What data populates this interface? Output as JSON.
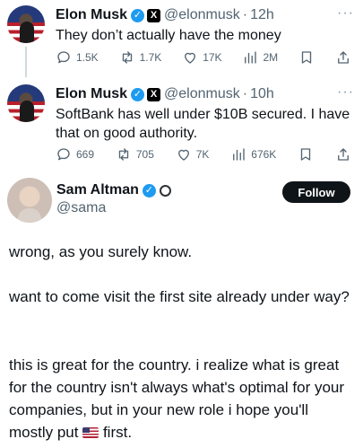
{
  "tweets": [
    {
      "author_name": "Elon Musk",
      "author_handle": "@elonmusk",
      "time": "12h",
      "text": "They don’t actually have the money",
      "stats": {
        "replies": "1.5K",
        "reposts": "1.7K",
        "likes": "17K",
        "views": "2M"
      }
    },
    {
      "author_name": "Elon Musk",
      "author_handle": "@elonmusk",
      "time": "10h",
      "text": "SoftBank has well under $10B secured. I have that on good authority.",
      "stats": {
        "replies": "669",
        "reposts": "705",
        "likes": "7K",
        "views": "676K"
      }
    }
  ],
  "main_post": {
    "author_name": "Sam Altman",
    "author_handle": "@sama",
    "follow_label": "Follow",
    "paragraphs": [
      "wrong, as you surely know.",
      "want to come visit the first site already under way?",
      "this is great for the country. i realize what is great for the country isn't always what's optimal for your companies, but in your new role i hope you'll mostly put",
      "first."
    ]
  },
  "icons": [
    "reply-icon",
    "repost-icon",
    "like-icon",
    "views-icon",
    "bookmark-icon",
    "share-icon",
    "more-icon",
    "verified-icon",
    "x-affiliate-icon",
    "openai-affiliate-icon",
    "us-flag-emoji"
  ],
  "colors": {
    "verified": "#1d9bf0",
    "secondary_text": "#536471",
    "follow_button": "#0f1419"
  },
  "more_glyph": "···",
  "separator_glyph": "·"
}
